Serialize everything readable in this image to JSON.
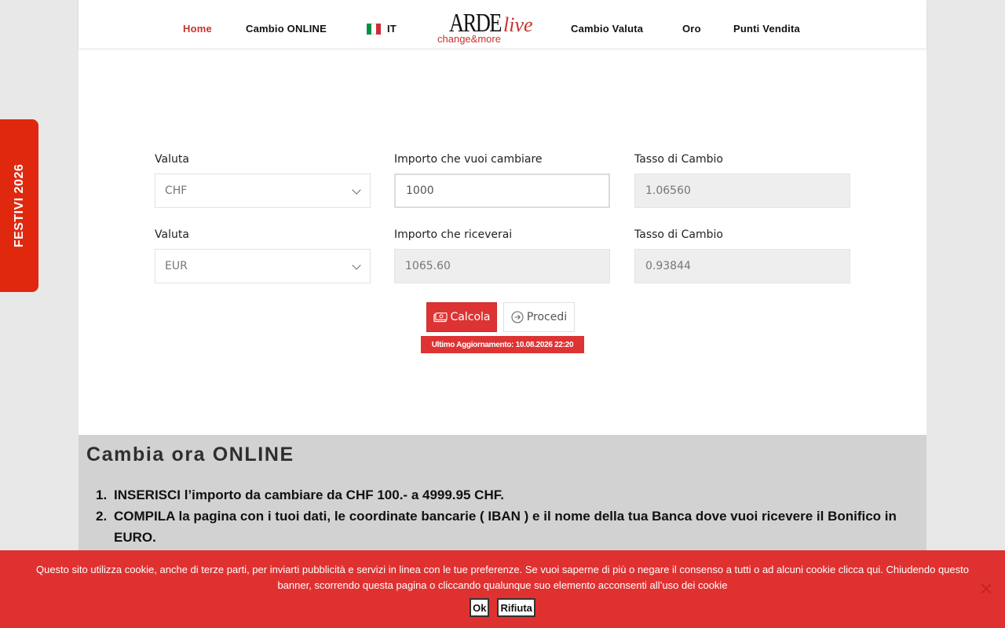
{
  "nav": {
    "home": "Home",
    "cambio_online": "Cambio ONLINE",
    "language": "IT",
    "cambio_valuta": "Cambio Valuta",
    "oro": "Oro",
    "punti_vendita": "Punti Vendita"
  },
  "logo": {
    "main": "ARDE",
    "live": "live",
    "tagline": "change&more"
  },
  "side_tab": {
    "label": "FESTIVI 2026"
  },
  "form": {
    "row1": {
      "currency_label": "Valuta",
      "currency_value": "CHF",
      "amount_label": "Importo che vuoi cambiare",
      "amount_value": "1000",
      "rate_label": "Tasso di Cambio",
      "rate_value": "1.06560"
    },
    "row2": {
      "currency_label": "Valuta",
      "currency_value": "EUR",
      "amount_label": "Importo che riceverai",
      "amount_value": "1065.60",
      "rate_label": "Tasso di Cambio",
      "rate_value": "0.93844"
    },
    "calcola_label": "Calcola",
    "procedi_label": "Procedi",
    "last_update": "Ultimo Aggiornamento: 10.08.2026 22:20"
  },
  "info": {
    "title": "Cambia ora ONLINE",
    "steps": [
      {
        "num": "1.",
        "text": "INSERISCI l’importo da cambiare da CHF 100.- a 4999.95 CHF."
      },
      {
        "num": "2.",
        "text": "COMPILA la pagina con i tuoi dati, le coordinate bancarie ( IBAN ) e il nome della tua Banca dove vuoi ricevere il Bonifico in EURO."
      }
    ]
  },
  "cookie": {
    "text": "Questo sito utilizza cookie, anche di terze parti, per inviarti pubblicità e servizi in linea con le tue preferenze. Se vuoi saperne di più o negare il consenso a tutti o ad alcuni cookie clicca qui. Chiudendo questo banner, scorrendo questa pagina o cliccando qualunque suo elemento acconsenti all’uso dei cookie",
    "ok_label": "Ok",
    "reject_label": "Rifiuta"
  },
  "colors": {
    "brand_red": "#dd3333",
    "side_tab": "#e0280f",
    "flag_green": "#009246",
    "flag_white": "#ffffff",
    "flag_red": "#ce2b37"
  }
}
